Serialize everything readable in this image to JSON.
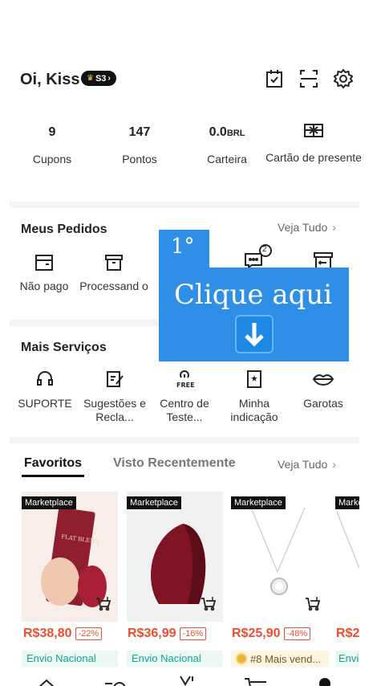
{
  "header": {
    "greeting": "Oi, Kiss",
    "badge": "S3"
  },
  "stats": [
    {
      "value": "9",
      "unit": "",
      "label": "Cupons"
    },
    {
      "value": "147",
      "unit": "",
      "label": "Pontos"
    },
    {
      "value": "0.0",
      "unit": "BRL",
      "label": "Carteira"
    },
    {
      "value": "",
      "unit": "",
      "label": "Cartão de presente"
    }
  ],
  "orders": {
    "title": "Meus Pedidos",
    "see_all": "Veja Tudo",
    "items": [
      {
        "label": "Não pago"
      },
      {
        "label": "Processand o"
      },
      {
        "badge": "2"
      }
    ]
  },
  "overlay": {
    "step": "1°",
    "text": "Clique aqui"
  },
  "services": {
    "title": "Mais Serviços",
    "items": [
      {
        "label": "SUPORTE"
      },
      {
        "label": "Sugestões e Recla..."
      },
      {
        "label": "Centro de Teste..."
      },
      {
        "label": "Minha indicação"
      },
      {
        "label": "Garotas"
      }
    ]
  },
  "favorites": {
    "tab_active": "Favoritos",
    "tab_inactive": "Visto Recentemente",
    "see_all": "Veja Tudo",
    "products": [
      {
        "tag": "Marketplace",
        "price": "R$38,80",
        "discount": "-22%",
        "shipping": "Envio Nacional",
        "image_text": "FLAT BLEND"
      },
      {
        "tag": "Marketplace",
        "price": "R$36,99",
        "discount": "-16%",
        "shipping": "Envio Nacional"
      },
      {
        "tag": "Marketplace",
        "price": "R$25,90",
        "discount": "-48%",
        "shipping": "#8 Mais vend..."
      },
      {
        "tag": "Marke",
        "price": "R$2",
        "discount": "",
        "shipping": "Envi"
      }
    ]
  },
  "colors": {
    "accent": "#ee4d2d",
    "overlay": "#2f8fe6",
    "shipping": "#1aa38a"
  }
}
